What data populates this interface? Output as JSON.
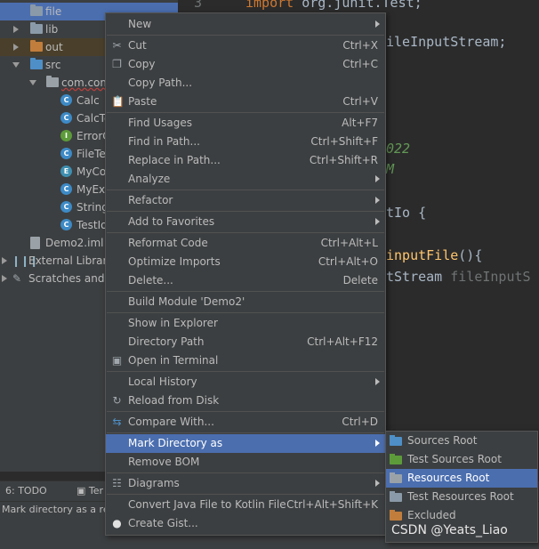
{
  "tree": {
    "rows": [
      {
        "label": "file"
      },
      {
        "label": "lib"
      },
      {
        "label": "out"
      },
      {
        "label": "src"
      },
      {
        "label": "com.com"
      },
      {
        "label": "Calc",
        "badge": "C"
      },
      {
        "label": "CalcTe",
        "badge": "C"
      },
      {
        "label": "ErrorC",
        "badge": "I"
      },
      {
        "label": "FileTes",
        "badge": "C"
      },
      {
        "label": "MyCo",
        "badge": "E"
      },
      {
        "label": "MyExc",
        "badge": "C"
      },
      {
        "label": "StringT",
        "badge": "C"
      },
      {
        "label": "TestIo",
        "badge": "C"
      },
      {
        "label": "Demo2.iml"
      },
      {
        "label": "External Libraries"
      },
      {
        "label": "Scratches and Co"
      }
    ]
  },
  "editor": {
    "gutter_number": "3",
    "lines": [
      {
        "a": "import",
        "b": " org.junit.Test;"
      },
      {
        "a": "",
        "b": "ileInputStream;"
      },
      {
        "a": "",
        "b": "022"
      },
      {
        "a": "",
        "b": "M"
      },
      {
        "a": "",
        "b": "tIo {"
      },
      {
        "a": "",
        "b": "inputFile",
        "c": "(){"
      },
      {
        "a": "",
        "b": "tStream ",
        "c": "fileInputS"
      }
    ]
  },
  "menu": {
    "items": [
      {
        "label": "New",
        "shortcut": ""
      },
      {
        "label": "Cut",
        "shortcut": "Ctrl+X",
        "icon": "✂"
      },
      {
        "label": "Copy",
        "shortcut": "Ctrl+C",
        "icon": "❐"
      },
      {
        "label": "Copy Path...",
        "shortcut": ""
      },
      {
        "label": "Paste",
        "shortcut": "Ctrl+V",
        "icon": "📋"
      },
      {
        "label": "Find Usages",
        "shortcut": "Alt+F7"
      },
      {
        "label": "Find in Path...",
        "shortcut": "Ctrl+Shift+F"
      },
      {
        "label": "Replace in Path...",
        "shortcut": "Ctrl+Shift+R"
      },
      {
        "label": "Analyze",
        "shortcut": ""
      },
      {
        "label": "Refactor",
        "shortcut": ""
      },
      {
        "label": "Add to Favorites",
        "shortcut": ""
      },
      {
        "label": "Reformat Code",
        "shortcut": "Ctrl+Alt+L"
      },
      {
        "label": "Optimize Imports",
        "shortcut": "Ctrl+Alt+O"
      },
      {
        "label": "Delete...",
        "shortcut": "Delete"
      },
      {
        "label": "Build Module 'Demo2'",
        "shortcut": ""
      },
      {
        "label": "Show in Explorer",
        "shortcut": ""
      },
      {
        "label": "Directory Path",
        "shortcut": "Ctrl+Alt+F12"
      },
      {
        "label": "Open in Terminal",
        "shortcut": ""
      },
      {
        "label": "Local History",
        "shortcut": ""
      },
      {
        "label": "Reload from Disk",
        "shortcut": ""
      },
      {
        "label": "Compare With...",
        "shortcut": "Ctrl+D"
      },
      {
        "label": "Mark Directory as",
        "shortcut": ""
      },
      {
        "label": "Remove BOM",
        "shortcut": ""
      },
      {
        "label": "Diagrams",
        "shortcut": ""
      },
      {
        "label": "Convert Java File to Kotlin File",
        "shortcut": "Ctrl+Alt+Shift+K"
      },
      {
        "label": "Create Gist...",
        "shortcut": ""
      }
    ]
  },
  "submenu": {
    "items": [
      {
        "label": "Sources Root"
      },
      {
        "label": "Test Sources Root"
      },
      {
        "label": "Resources Root"
      },
      {
        "label": "Test Resources Root"
      },
      {
        "label": "Excluded"
      }
    ]
  },
  "bottom": {
    "tab_todo": "6: TODO",
    "tab_terminal": "Ter"
  },
  "status": {
    "text": "Mark directory as a reso"
  },
  "watermark": "CSDN @Yeats_Liao",
  "colors": {
    "selection": "#4b6eaf",
    "menu_bg": "#3c3f41",
    "editor_bg": "#2b2b2b"
  }
}
